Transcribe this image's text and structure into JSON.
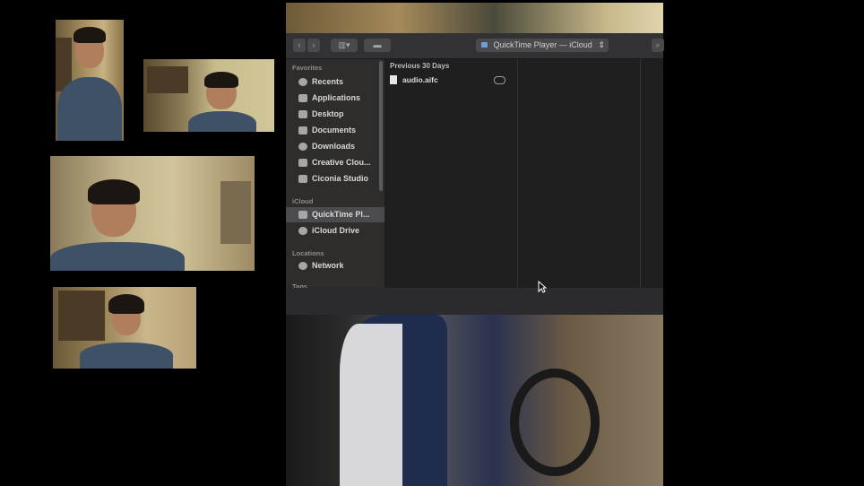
{
  "finder": {
    "path_popup": "QuickTime Player — iCloud",
    "sidebar": {
      "sections": [
        {
          "title": "Favorites"
        },
        {
          "title": "iCloud"
        },
        {
          "title": "Locations"
        },
        {
          "title": "Tags"
        }
      ],
      "items": [
        {
          "label": "Recents",
          "icon": "clock-icon"
        },
        {
          "label": "Applications",
          "icon": "applications-icon"
        },
        {
          "label": "Desktop",
          "icon": "desktop-icon"
        },
        {
          "label": "Documents",
          "icon": "document-icon"
        },
        {
          "label": "Downloads",
          "icon": "download-icon"
        },
        {
          "label": "Creative Clou...",
          "icon": "folder-icon"
        },
        {
          "label": "Ciconia Studio",
          "icon": "folder-icon"
        },
        {
          "label": "QuickTime Pl...",
          "icon": "applications-icon",
          "selected": true
        },
        {
          "label": "iCloud Drive",
          "icon": "cloud-icon"
        },
        {
          "label": "Network",
          "icon": "globe-icon"
        }
      ]
    },
    "list": {
      "group_header": "Previous 30 Days",
      "files": [
        {
          "name": "audio.aifc",
          "status_icon": "cloud-download-icon"
        }
      ]
    }
  },
  "colors": {
    "background": "#000000",
    "window": "#1e1e1f",
    "sidebar": "#2e2d2b",
    "selection": "#4b4b4d"
  }
}
